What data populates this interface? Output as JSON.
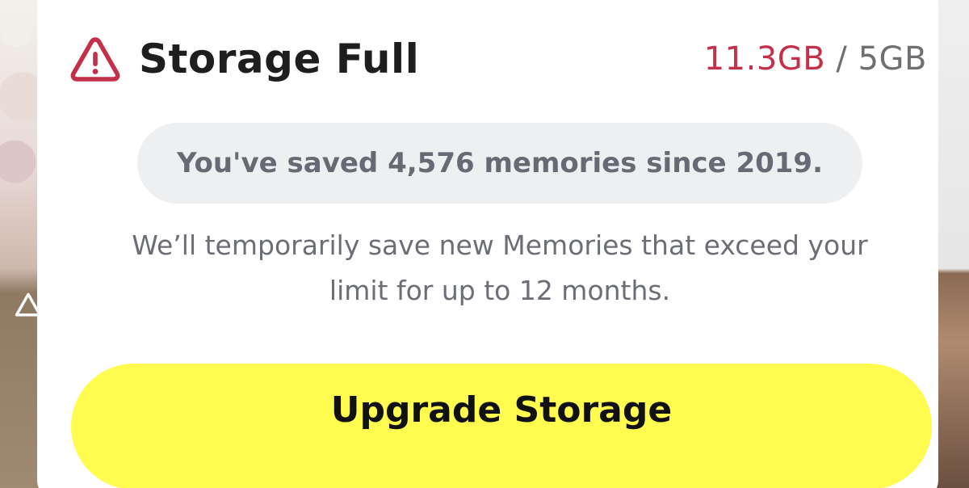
{
  "dialog": {
    "title": "Storage Full",
    "usage_used": "11.3GB",
    "usage_separator": " / ",
    "usage_limit": "5GB",
    "summary": "You've saved 4,576 memories since 2019.",
    "description_line1": "We’ll temporarily save new Memories that exceed your",
    "description_line2": "limit for up to 12 months.",
    "primary_button_label": "Upgrade Storage",
    "warning_icon": "warning-triangle-icon"
  },
  "colors": {
    "accent_red": "#c42f4a",
    "button_yellow": "#fffc4f",
    "pill_gray": "#eeeff1",
    "text_dark": "#1e1e1e",
    "text_muted": "#6b6e77"
  }
}
